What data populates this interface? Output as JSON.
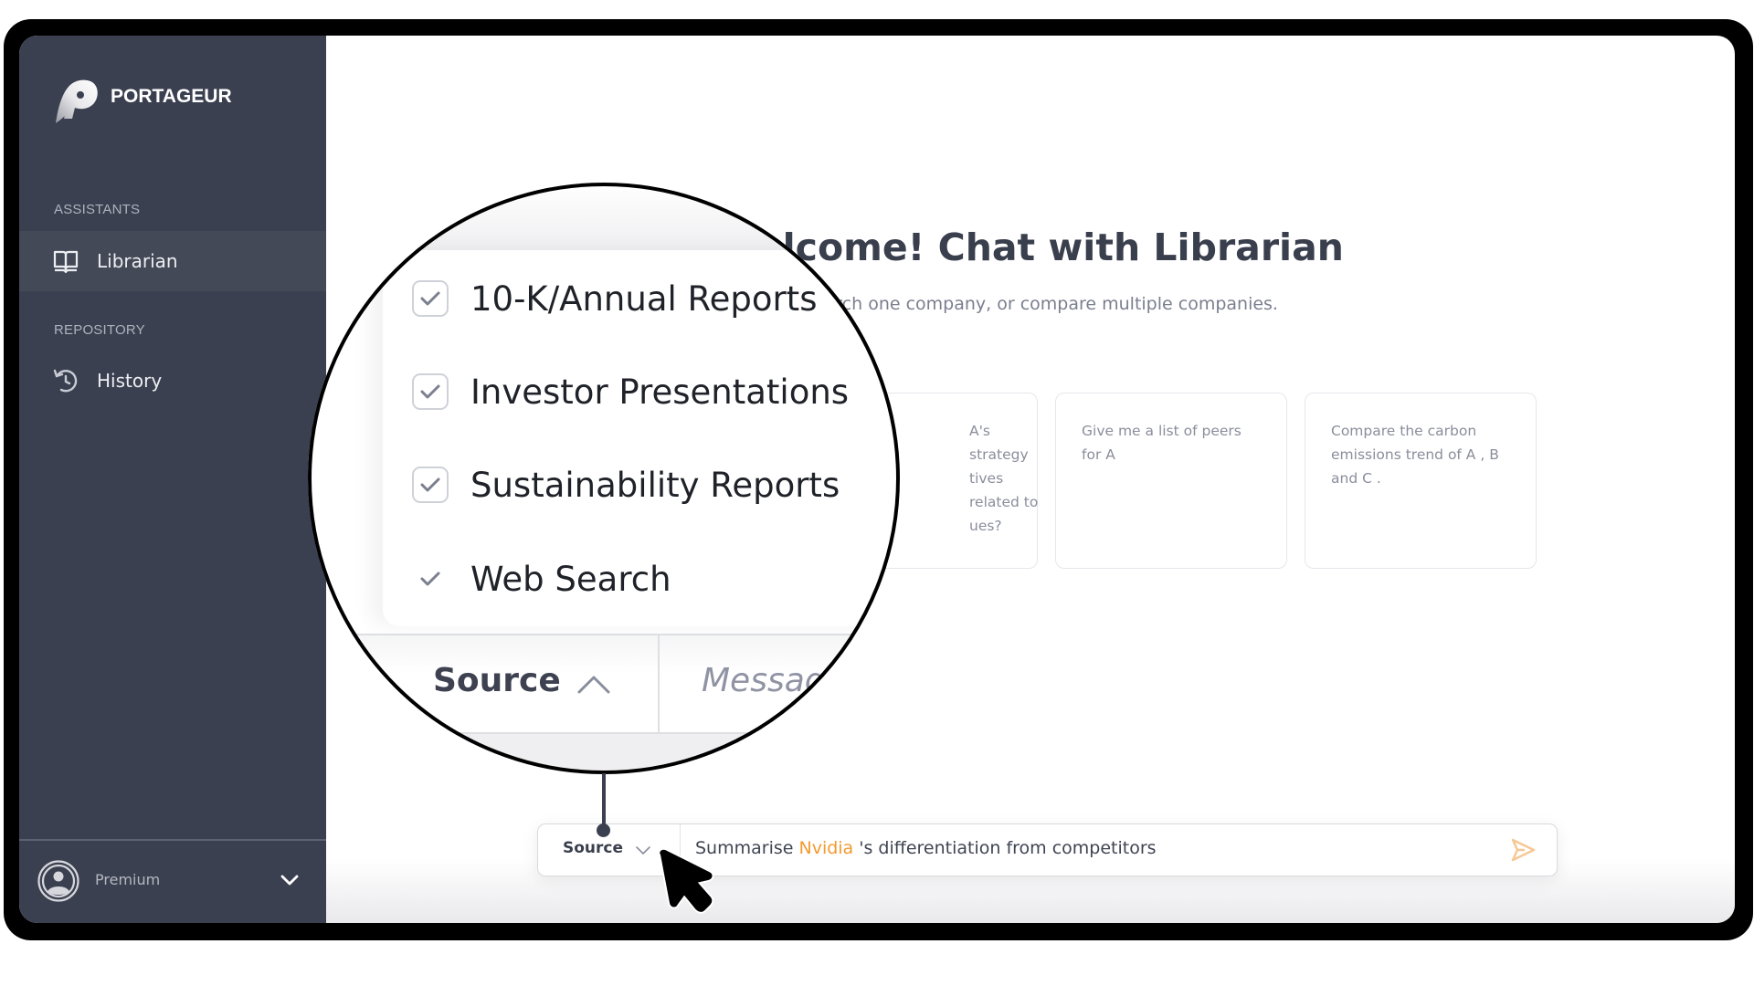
{
  "app": {
    "brand": "PORTAGEUR"
  },
  "sidebar": {
    "sections": [
      {
        "label": "ASSISTANTS",
        "items": [
          {
            "label": "Librarian",
            "icon": "book-open-icon",
            "active": true
          }
        ]
      },
      {
        "label": "REPOSITORY",
        "items": [
          {
            "label": "History",
            "icon": "history-icon",
            "active": false
          }
        ]
      }
    ],
    "user": {
      "plan": "Premium",
      "icon": "user-circle-icon"
    }
  },
  "main": {
    "title": "Welcome! Chat with Librarian",
    "subtitle": "Research one company, or compare multiple companies.",
    "suggestions": [
      {
        "text": "A's strategy tives related to ues?"
      },
      {
        "text": "Give me a list of peers for A"
      },
      {
        "text": "Compare the carbon emissions trend of A , B and C ."
      }
    ],
    "chat_bar": {
      "source_label": "Source",
      "message_parts": [
        "Summarise ",
        "Nvidia",
        " 's differentiation from competitors"
      ],
      "highlight_color": "#f39a2e",
      "send_icon": "send-icon"
    }
  },
  "magnifier": {
    "source_options": [
      {
        "label": "10-K/Annual Reports",
        "checked": true,
        "style": "checkbox"
      },
      {
        "label": "Investor Presentations",
        "checked": true,
        "style": "checkbox"
      },
      {
        "label": "Sustainability Reports",
        "checked": true,
        "style": "checkbox"
      },
      {
        "label": "Web Search",
        "checked": true,
        "style": "check"
      }
    ],
    "source_label": "Source",
    "message_placeholder": "Messag"
  },
  "colors": {
    "sidebar_bg": "#3b4050",
    "sidebar_active": "#444957",
    "accent": "#f39a2e",
    "title": "#3a3f4d"
  }
}
